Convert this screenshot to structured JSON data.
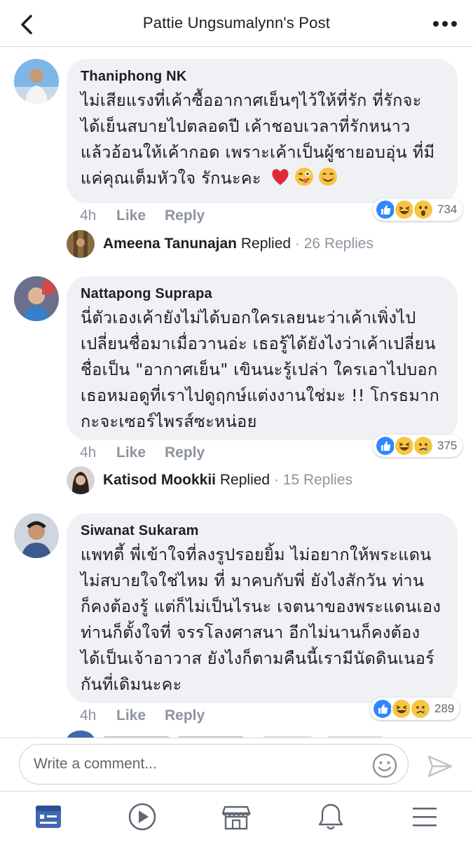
{
  "header": {
    "title": "Pattie Ungsumalynn's Post"
  },
  "comments": [
    {
      "author": "Thaniphong NK",
      "text": "ไม่เสียแรงที่เค้าซื้ออากาศเย็นๆไว้ให้ที่รัก ที่รักจะ\nได้เย็นสบายไปตลอดปี เค้าชอบเวลาที่รักหนาว\nแล้วอ้อนให้เค้ากอด เพราะเค้าเป็นผู้ชายอบอุ่น ที่มี\nแค่คุณเต็มหัวใจ รักนะคะ",
      "emojis": [
        "red-heart-icon",
        "winking-tongue-face-icon",
        "smiling-face-icon"
      ],
      "time": "4h",
      "like": "Like",
      "reply": "Reply",
      "reactions": [
        "like",
        "haha",
        "wow"
      ],
      "reaction_count": "734",
      "replies": {
        "name": "Ameena Tanunajan",
        "verb": "Replied",
        "count": "· 26 Replies"
      }
    },
    {
      "author": "Nattapong Suprapa",
      "text": "นี่ตัวเองเค้ายังไม่ได้บอกใครเลยนะว่าเค้าเพิ่งไป\nเปลี่ยนชื่อมาเมื่อวานอ่ะ เธอรู้ได้ยังไงว่าเค้าเปลี่ยน\nชื่อเป็น \"อากาศเย็น\" เขินนะรู้เปล่า ใครเอาไปบอก\nเธอหมอดูที่เราไปดูฤกษ์แต่งงานใช่มะ !! โกรธมาก\nกะจะเซอร์ไพรส์ซะหน่อย",
      "time": "4h",
      "like": "Like",
      "reply": "Reply",
      "reactions": [
        "like",
        "haha",
        "sad"
      ],
      "reaction_count": "375",
      "replies": {
        "name": "Katisod Mookkii",
        "verb": "Replied",
        "count": "· 15 Replies"
      }
    },
    {
      "author": "Siwanat Sukaram",
      "text": "แพทตี้ พี่เข้าใจที่ลงรูปรอยยิ้ม ไม่อยากให้พระแดน\nไม่สบายใจใช่ไหม ที่ มาคบกับพี่ ยังไงสักวัน ท่าน\nก็คงต้องรู้ แต่ก็ไม่เป็นไรนะ เจตนาของพระแดนเอง\nท่านก็ตั้งใจที่ จรรโลงศาสนา อีกไม่นานก็คงต้อง\nได้เป็นเจ้าอาวาส ยังไงก็ตามคืนนี้เรามีนัดดินเนอร์\nกันที่เดิมนะคะ",
      "time": "4h",
      "like": "Like",
      "reply": "Reply",
      "reactions": [
        "like",
        "haha",
        "sad"
      ],
      "reaction_count": "289"
    }
  ],
  "composer": {
    "placeholder": "Write a comment..."
  },
  "tabs": [
    "news-feed",
    "watch",
    "marketplace",
    "notifications",
    "menu"
  ],
  "colors": {
    "accent": "#4267b2",
    "bubble": "#f0f1f4",
    "muted": "#8d949e",
    "like_blue": "#2d88ff",
    "reaction_yellow": "#f7c542"
  }
}
